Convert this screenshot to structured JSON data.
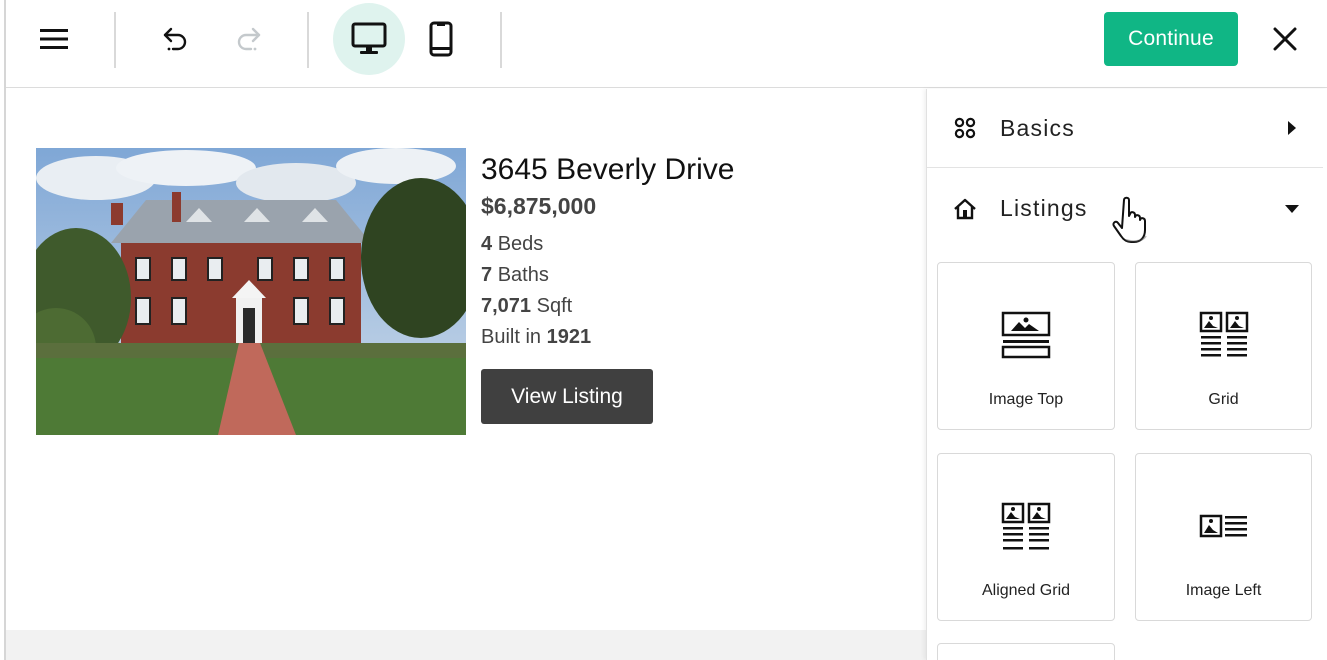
{
  "toolbar": {
    "menu_icon": "hamburger-menu-icon",
    "undo_icon": "undo-icon",
    "redo_icon": "redo-icon",
    "desktop_icon": "desktop-monitor-icon",
    "mobile_icon": "mobile-phone-icon",
    "continue_label": "Continue",
    "close_icon": "close-icon",
    "accent_color": "#10b685",
    "active_view_bg": "#dff3ee"
  },
  "listing": {
    "address": "3645 Beverly Drive",
    "price": "$6,875,000",
    "beds_value": "4",
    "beds_label": "Beds",
    "baths_value": "7",
    "baths_label": "Baths",
    "sqft_value": "7,071",
    "sqft_label": "Sqft",
    "built_label": "Built in",
    "built_value": "1921",
    "button_label": "View Listing",
    "button_color": "#404040"
  },
  "panel": {
    "sections": [
      {
        "label": "Basics",
        "icon": "four-dots-grid-icon",
        "state": "collapsed"
      },
      {
        "label": "Listings",
        "icon": "house-icon",
        "state": "expanded"
      }
    ],
    "layouts": [
      {
        "label": "Image Top",
        "icon": "image-top-layout-icon"
      },
      {
        "label": "Grid",
        "icon": "grid-layout-icon"
      },
      {
        "label": "Aligned Grid",
        "icon": "aligned-grid-layout-icon"
      },
      {
        "label": "Image Left",
        "icon": "image-left-layout-icon"
      }
    ]
  }
}
